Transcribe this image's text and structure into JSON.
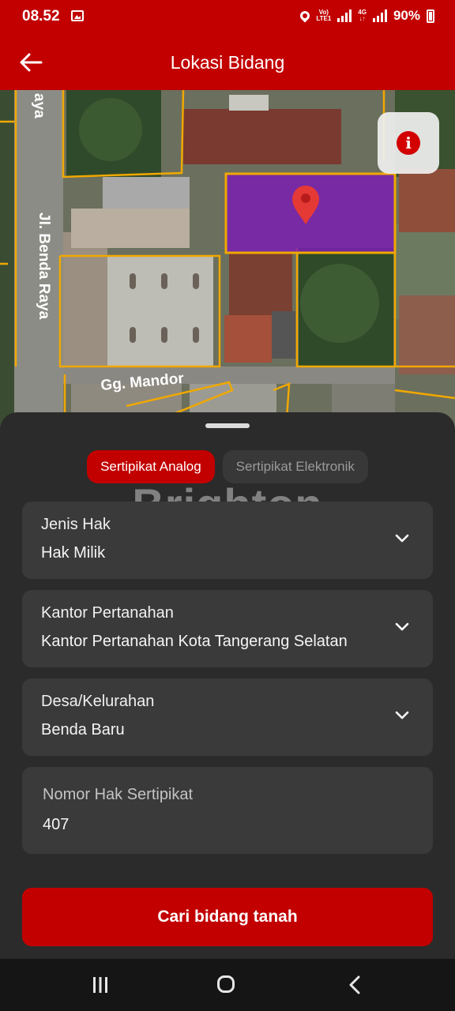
{
  "status_bar": {
    "time": "08.52",
    "network_label_top": "Vo)",
    "network_label_bottom": "LTE1",
    "network_type_top": "4G",
    "network_type_bottom": "↓↑",
    "battery": "90%"
  },
  "app_bar": {
    "title": "Lokasi Bidang",
    "back_icon": "arrow-left-icon"
  },
  "map": {
    "street_labels": [
      "Jl. Benda Raya",
      "Gg. Mandor",
      "aya"
    ],
    "info_icon": "info-icon",
    "marker_icon": "location-pin-icon",
    "parcel_highlight_color": "#7a1fb0",
    "parcel_border_color": "#f0a800"
  },
  "sheet": {
    "tabs": [
      {
        "label": "Sertipikat Analog",
        "active": true
      },
      {
        "label": "Sertipikat Elektronik",
        "active": false
      }
    ],
    "watermark": "Brighton",
    "fields": [
      {
        "label": "Jenis Hak",
        "value": "Hak Milik",
        "type": "dropdown"
      },
      {
        "label": "Kantor Pertanahan",
        "value": "Kantor Pertanahan Kota Tangerang Selatan",
        "type": "dropdown"
      },
      {
        "label": "Desa/Kelurahan",
        "value": "Benda Baru",
        "type": "dropdown"
      },
      {
        "label": "Nomor Hak Sertipikat",
        "value": "407",
        "type": "text"
      }
    ],
    "submit_label": "Cari bidang tanah"
  },
  "colors": {
    "brand": "#c20000",
    "sheet_bg": "#2b2b2b",
    "field_bg": "#3a3a3a"
  }
}
